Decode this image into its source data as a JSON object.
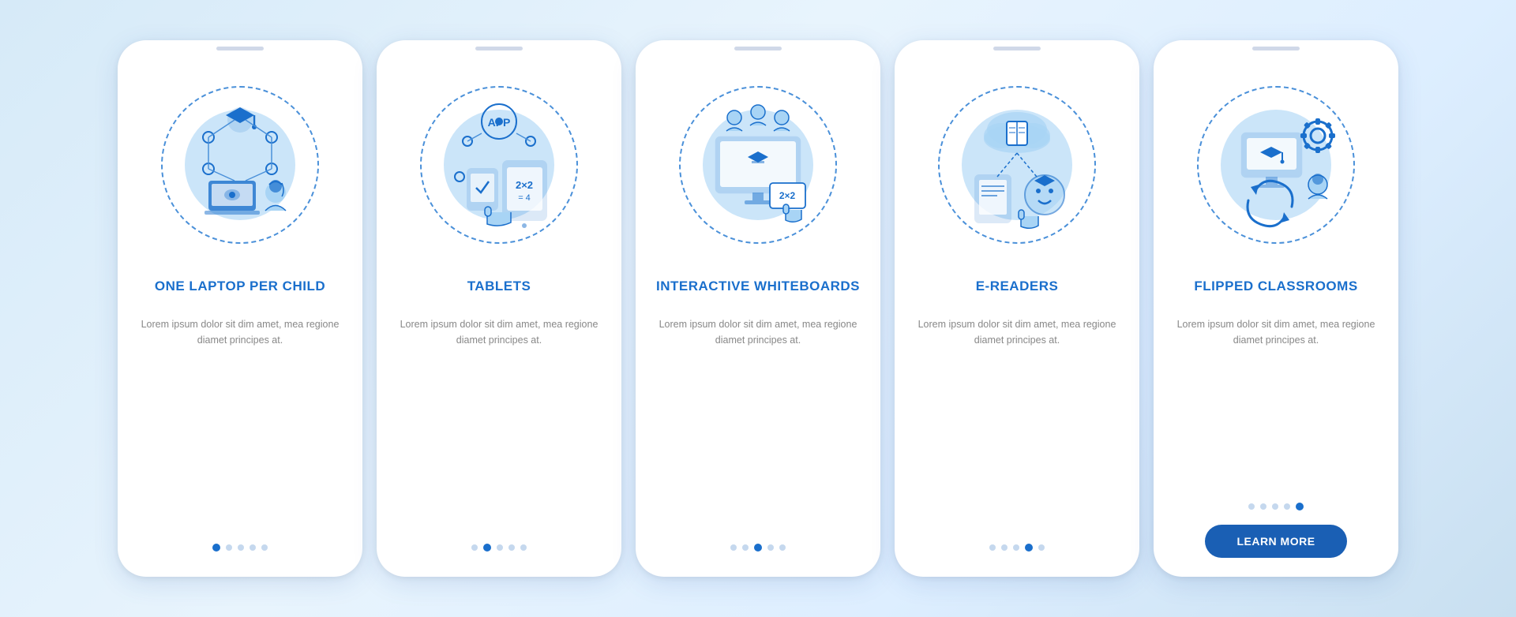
{
  "cards": [
    {
      "id": "one-laptop",
      "title": "ONE LAPTOP\nPER CHILD",
      "description": "Lorem ipsum dolor sit dim amet, mea regione diamet principes at.",
      "dots": [
        true,
        false,
        false,
        false,
        false
      ],
      "active_dot": 0,
      "show_button": false
    },
    {
      "id": "tablets",
      "title": "TABLETS",
      "description": "Lorem ipsum dolor sit dim amet, mea regione diamet principes at.",
      "dots": [
        false,
        true,
        false,
        false,
        false
      ],
      "active_dot": 1,
      "show_button": false
    },
    {
      "id": "interactive-whiteboards",
      "title": "INTERACTIVE\nWHITEBOARDS",
      "description": "Lorem ipsum dolor sit dim amet, mea regione diamet principes at.",
      "dots": [
        false,
        false,
        true,
        false,
        false
      ],
      "active_dot": 2,
      "show_button": false
    },
    {
      "id": "e-readers",
      "title": "E-READERS",
      "description": "Lorem ipsum dolor sit dim amet, mea regione diamet principes at.",
      "dots": [
        false,
        false,
        false,
        true,
        false
      ],
      "active_dot": 3,
      "show_button": false
    },
    {
      "id": "flipped-classrooms",
      "title": "FLIPPED\nCLASSROOMS",
      "description": "Lorem ipsum dolor sit dim amet, mea regione diamet principes at.",
      "dots": [
        false,
        false,
        false,
        false,
        true
      ],
      "active_dot": 4,
      "show_button": true,
      "button_label": "LEARN MORE"
    }
  ],
  "brand_color": "#1a6fcc",
  "accent_color": "#1a5fb4"
}
